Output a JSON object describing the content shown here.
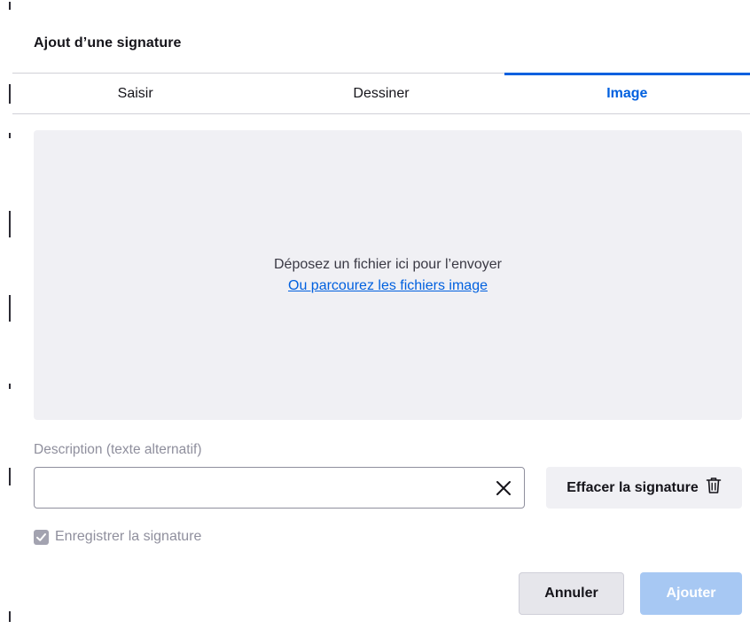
{
  "dialog": {
    "title": "Ajout d’une signature"
  },
  "tabs": [
    {
      "label": "Saisir",
      "active": false
    },
    {
      "label": "Dessiner",
      "active": false
    },
    {
      "label": "Image",
      "active": true
    }
  ],
  "drop_zone": {
    "text": "Déposez un fichier ici pour l’envoyer",
    "browse_link": "Ou parcourez les fichiers image"
  },
  "description": {
    "label": "Description (texte alternatif)",
    "value": "",
    "clear_icon": "close-icon"
  },
  "erase_button": {
    "label": "Effacer la signature",
    "icon": "trash-icon"
  },
  "save_checkbox": {
    "label": "Enregistrer la signature",
    "checked": true,
    "disabled": true
  },
  "footer": {
    "cancel_label": "Annuler",
    "add_label": "Ajouter"
  },
  "colors": {
    "accent": "#0060df",
    "drop_zone_bg": "#f0f0f4",
    "disabled_primary": "#a7c8f3",
    "muted_text": "#8f8f9d"
  }
}
